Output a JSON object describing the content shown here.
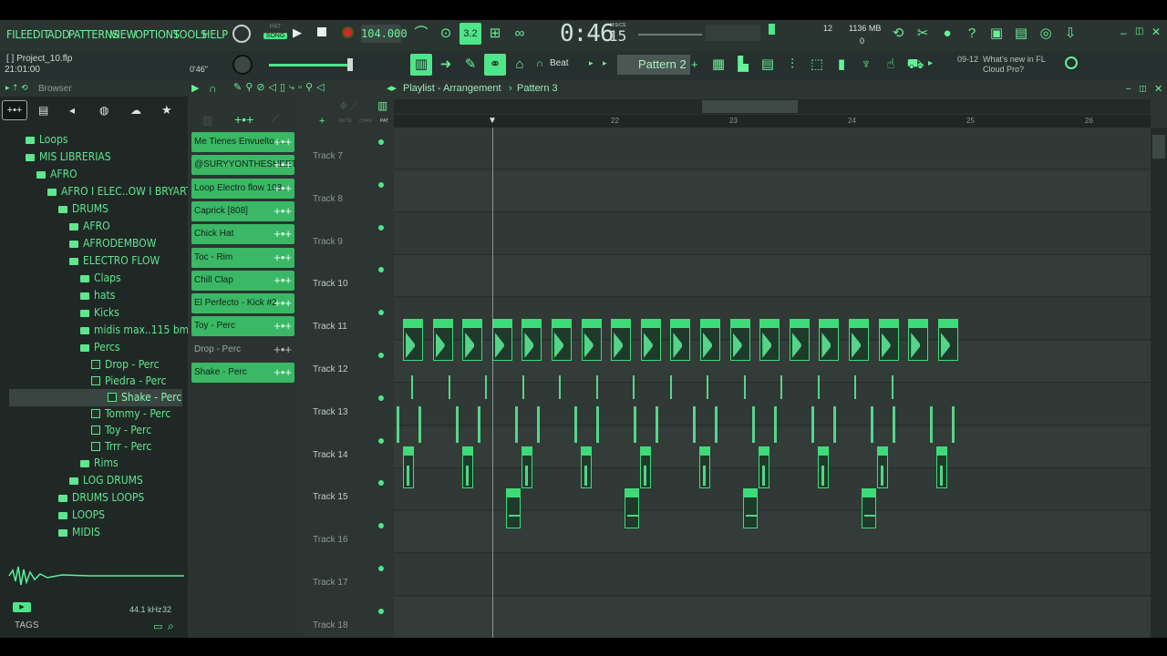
{
  "menu": [
    "FILE",
    "EDIT",
    "ADD",
    "PATTERNS",
    "VIEW",
    "OPTIONS",
    "TOOLS",
    "HELP"
  ],
  "transport": {
    "pat_label": "PAT",
    "song_label": "SONG",
    "tempo": "104.000",
    "time_main": "0:46",
    "time_sub": "15",
    "time_units": "M:S:CS",
    "cpu_voices": "12",
    "memory": "1136 MB",
    "mem_sub": "0"
  },
  "project": {
    "name": "[   ] Project_10.flp",
    "time": "21:01:00",
    "duration": "0'46\""
  },
  "toolbar": {
    "snap": "Beat",
    "pattern": "Pattern 2",
    "news_date": "09-12",
    "news_text": "What's new in FL Cloud Pro?"
  },
  "browser": {
    "title": "Browser",
    "tree": [
      {
        "label": "Loops",
        "type": "folder",
        "indent": 0
      },
      {
        "label": "MIS LIBRERIAS",
        "type": "folder",
        "indent": 0
      },
      {
        "label": "AFRO",
        "type": "folder",
        "indent": 1
      },
      {
        "label": "AFRO I ELEC..OW I BRYARTZZ",
        "type": "folder",
        "indent": 2
      },
      {
        "label": "DRUMS",
        "type": "folder",
        "indent": 3
      },
      {
        "label": "AFRO",
        "type": "folder",
        "indent": 4
      },
      {
        "label": "AFRODEMBOW",
        "type": "folder",
        "indent": 4
      },
      {
        "label": "ELECTRO FLOW",
        "type": "folder",
        "indent": 4
      },
      {
        "label": "Claps",
        "type": "folder",
        "indent": 5
      },
      {
        "label": "hats",
        "type": "folder",
        "indent": 5
      },
      {
        "label": "Kicks",
        "type": "folder",
        "indent": 5
      },
      {
        "label": "midis max..115 bmp",
        "type": "folder",
        "indent": 5
      },
      {
        "label": "Percs",
        "type": "folder",
        "indent": 5
      },
      {
        "label": "Drop - Perc",
        "type": "file",
        "indent": 6
      },
      {
        "label": "Piedra - Perc",
        "type": "file",
        "indent": 6
      },
      {
        "label": "Shake - Perc",
        "type": "file",
        "indent": 6,
        "selected": true
      },
      {
        "label": "Tommy - Perc",
        "type": "file",
        "indent": 6
      },
      {
        "label": "Toy - Perc",
        "type": "file",
        "indent": 6
      },
      {
        "label": "Trrr - Perc",
        "type": "file",
        "indent": 6
      },
      {
        "label": "Rims",
        "type": "folder",
        "indent": 5
      },
      {
        "label": "LOG DRUMS",
        "type": "folder",
        "indent": 4
      },
      {
        "label": "DRUMS LOOPS",
        "type": "folder",
        "indent": 3
      },
      {
        "label": "LOOPS",
        "type": "folder",
        "indent": 3
      },
      {
        "label": "MIDIS",
        "type": "folder",
        "indent": 3
      }
    ],
    "sample_rate": "44.1 kHz",
    "bit_depth": "32",
    "tags_label": "TAGS"
  },
  "channels": [
    {
      "label": "Me Tienes Envuelto -...",
      "on": true
    },
    {
      "label": "@SURYYONTHESHEET...",
      "on": true
    },
    {
      "label": "Loop Electro flow 108...",
      "on": true
    },
    {
      "label": "Caprick [808]",
      "on": true
    },
    {
      "label": "Chick Hat",
      "on": true
    },
    {
      "label": "Toc - Rim",
      "on": true
    },
    {
      "label": "Chill Clap",
      "on": true
    },
    {
      "label": "El Perfecto - Kick #2",
      "on": true
    },
    {
      "label": "Toy - Perc",
      "on": true
    },
    {
      "label": "Drop - Perc",
      "on": false
    },
    {
      "label": "Shake - Perc",
      "on": true
    }
  ],
  "playlist": {
    "breadcrumb": [
      "Playlist - Arrangement",
      "Pattern 3"
    ],
    "ruler": [
      "22",
      "23",
      "24",
      "25",
      "26"
    ],
    "tracks": [
      "Track 7",
      "Track 8",
      "Track 9",
      "Track 10",
      "Track 11",
      "Track 12",
      "Track 13",
      "Track 14",
      "Track 15",
      "Track 16",
      "Track 17",
      "Track 18"
    ],
    "mode_labels": [
      "NOTE",
      "CHAN",
      "PAT"
    ]
  },
  "colors": {
    "accent": "#4fe58a",
    "panel": "#2c3532"
  }
}
